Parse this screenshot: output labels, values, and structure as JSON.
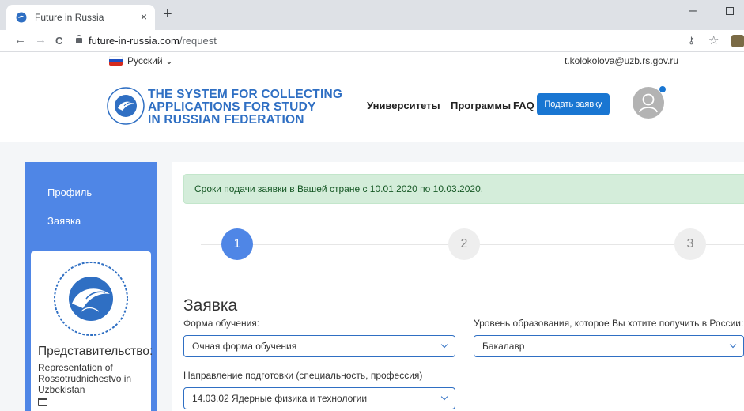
{
  "browser": {
    "tab_title": "Future in Russia",
    "tab_close": "×",
    "new_tab": "+",
    "url_host": "future-in-russia.com",
    "url_path": "/request",
    "back": "←",
    "forward": "→",
    "reload": "C",
    "minimize": "–",
    "key": "⚷",
    "star": "☆"
  },
  "topbar": {
    "language": "Русский ⌄",
    "email": "t.kolokolova@uzb.rs.gov.ru",
    "flag_colors": [
      "#ffffff",
      "#1f4fc1",
      "#d52b1e"
    ]
  },
  "header": {
    "brand_lines": [
      "THE SYSTEM FOR COLLECTING",
      "APPLICATIONS FOR STUDY",
      "IN RUSSIAN FEDERATION"
    ],
    "nav": [
      "Университеты",
      "Программы",
      "FAQ"
    ],
    "apply_button": "Подать заявку",
    "accent_color": "#1976d2",
    "brand_color": "#2f6fc3"
  },
  "sidebar": {
    "items": [
      "Профиль",
      "Заявка"
    ],
    "background": "#4f86e6",
    "rep_title": "Представительство:",
    "rep_name": "Representation of Rossotrudnichestvo in Uzbekistan",
    "calendar_icon": "calendar-icon"
  },
  "main": {
    "alert": "Сроки подачи заявки в Вашей стране с 10.01.2020 по 10.03.2020.",
    "steps": [
      "1",
      "2",
      "3"
    ],
    "active_step": 1,
    "section_title": "Заявка",
    "fields": {
      "study_form": {
        "label": "Форма обучения:",
        "value": "Очная форма обучения"
      },
      "education_level": {
        "label": "Уровень образования, которое Вы хотите получить в России:",
        "value": "Бакалавр"
      },
      "direction": {
        "label": "Направление подготовки (специальность, профессия)",
        "value": "14.03.02 Ядерные физика и технологии"
      }
    }
  }
}
